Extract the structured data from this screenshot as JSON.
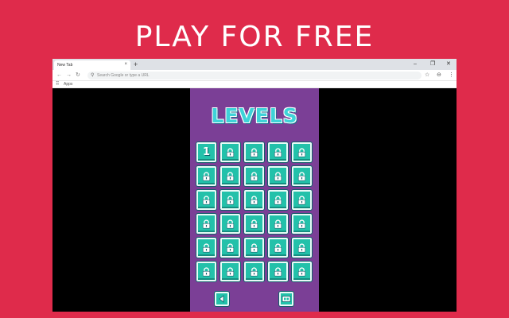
{
  "headline": "PLAY FOR FREE",
  "browser": {
    "tab_title": "New Tab",
    "tab_close": "×",
    "new_tab": "+",
    "window_controls": {
      "minimize": "–",
      "restore": "❐",
      "close": "✕"
    },
    "nav": {
      "back": "←",
      "forward": "→",
      "reload": "↻"
    },
    "omnibox_placeholder": "Search Google or type a URL",
    "omnibox_icon": "search-icon",
    "toolbar": {
      "bookmark_star": "☆",
      "profile": "⊖",
      "menu": "⋮"
    },
    "bookmarks_bar": {
      "apps_icon": "⠿",
      "apps_label": "Apps"
    }
  },
  "game": {
    "title": "LEVELS",
    "levels": [
      {
        "label": "1",
        "locked": false
      },
      {
        "label": "",
        "locked": true
      },
      {
        "label": "",
        "locked": true
      },
      {
        "label": "",
        "locked": true
      },
      {
        "label": "",
        "locked": true
      },
      {
        "label": "",
        "locked": true
      },
      {
        "label": "",
        "locked": true
      },
      {
        "label": "",
        "locked": true
      },
      {
        "label": "",
        "locked": true
      },
      {
        "label": "",
        "locked": true
      },
      {
        "label": "",
        "locked": true
      },
      {
        "label": "",
        "locked": true
      },
      {
        "label": "",
        "locked": true
      },
      {
        "label": "",
        "locked": true
      },
      {
        "label": "",
        "locked": true
      },
      {
        "label": "",
        "locked": true
      },
      {
        "label": "",
        "locked": true
      },
      {
        "label": "",
        "locked": true
      },
      {
        "label": "",
        "locked": true
      },
      {
        "label": "",
        "locked": true
      },
      {
        "label": "",
        "locked": true
      },
      {
        "label": "",
        "locked": true
      },
      {
        "label": "",
        "locked": true
      },
      {
        "label": "",
        "locked": true
      },
      {
        "label": "",
        "locked": true
      },
      {
        "label": "",
        "locked": true
      },
      {
        "label": "",
        "locked": true
      },
      {
        "label": "",
        "locked": true
      },
      {
        "label": "",
        "locked": true
      },
      {
        "label": "",
        "locked": true
      }
    ],
    "back_icon": "back-arrow-icon",
    "shop_icon": "shop-icon"
  },
  "colors": {
    "page_background": "#df2b4b",
    "game_background": "#7b3f96",
    "button_fill": "#23c1aa",
    "title_color": "#3ed3d8"
  }
}
